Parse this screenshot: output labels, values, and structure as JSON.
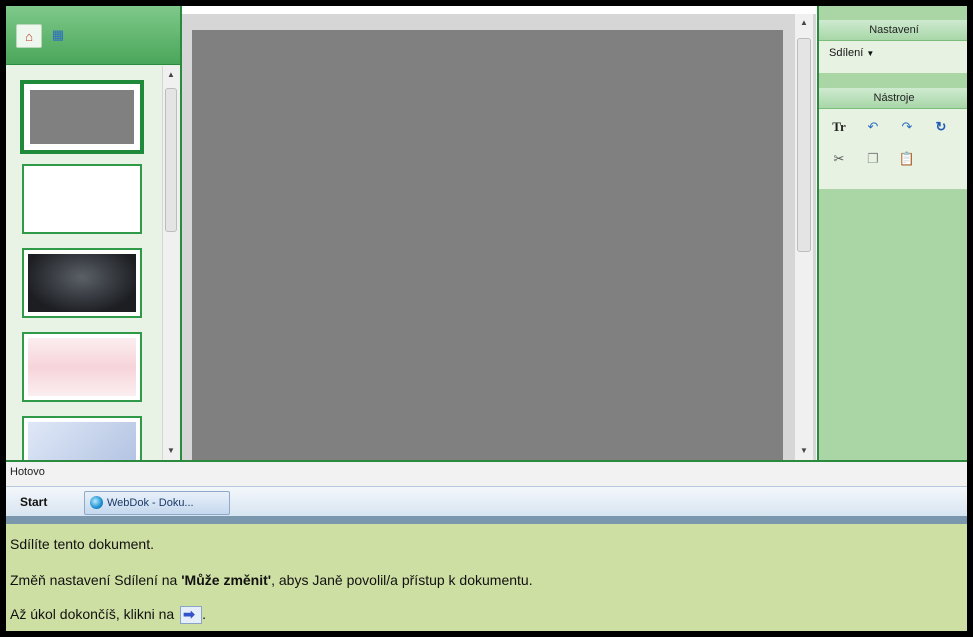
{
  "settings_panel": {
    "title": "Nastavení",
    "share_label": "Sdílení"
  },
  "tools_panel": {
    "title": "Nástroje",
    "format_text_label": "Tr"
  },
  "status": {
    "text": "Hotovo"
  },
  "taskbar": {
    "start_label": "Start",
    "window_item_label": "WebDok - Doku..."
  },
  "instructions": {
    "line1": "Sdílíte tento dokument.",
    "line2_prefix": "Změň nastavení Sdílení na ",
    "line2_bold": "'Může změnit'",
    "line2_suffix": ", abys Janě povolil/a přístup k dokumentu.",
    "line3": "Až úkol dokončíš, klikni na"
  },
  "icons": {
    "home_view": "home-icon",
    "grid_view": "grid-icon",
    "undo": "undo-icon",
    "redo": "redo-icon",
    "refresh": "refresh-icon",
    "cut": "cut-icon",
    "copy": "copy-icon",
    "paste": "paste-icon",
    "next_arrow": "right-arrow-icon"
  },
  "colors": {
    "accent_green": "#2a8a3e",
    "panel_green": "#a9d6a4",
    "instruction_bg": "#cedfa3",
    "canvas_gray": "#808080"
  }
}
